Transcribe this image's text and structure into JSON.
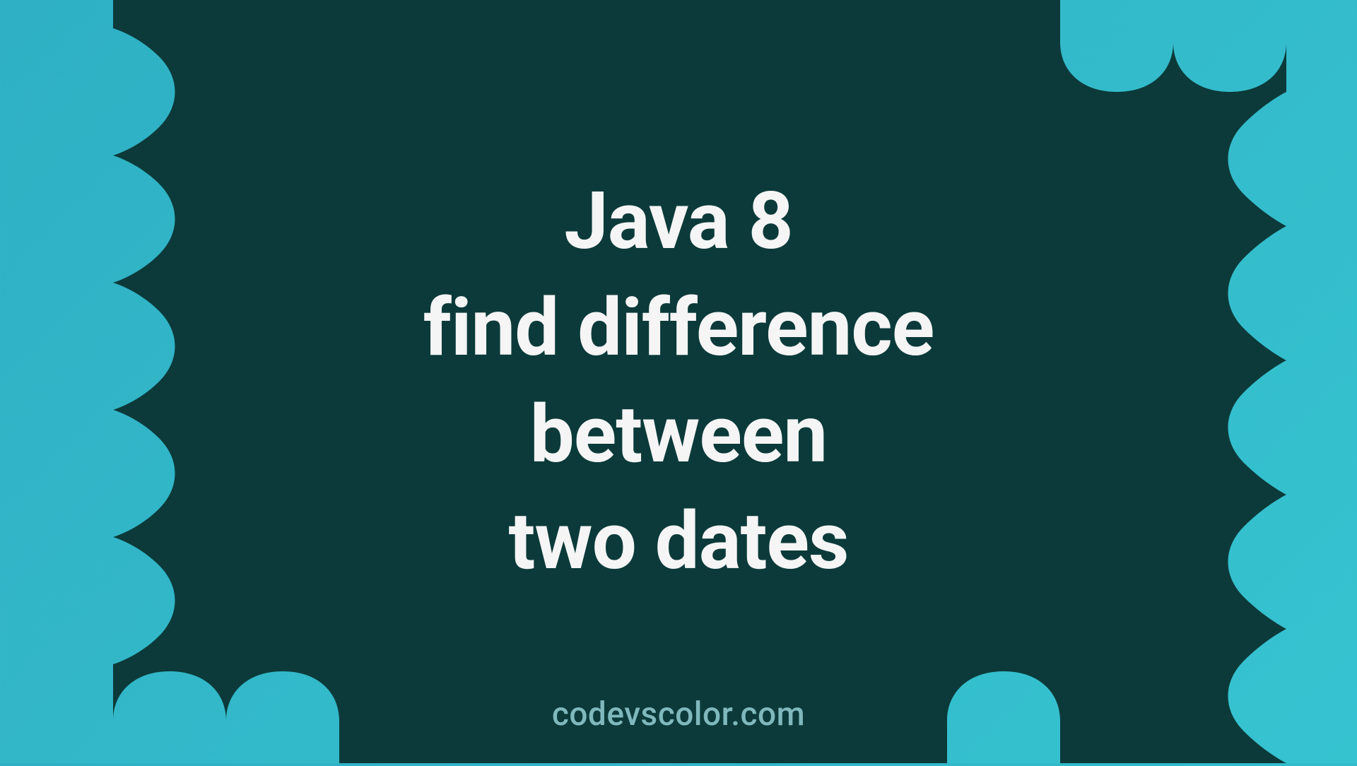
{
  "title": {
    "line1": "Java 8",
    "line2": "find difference",
    "line3": "between",
    "line4": "two dates"
  },
  "subtitle": "codevscolor.com",
  "colors": {
    "bg_start": "#2fb0c4",
    "bg_end": "#36c3d0",
    "blob": "#0c3a3a",
    "text": "#f5f5f5",
    "subtitle": "#7fb8bd"
  }
}
